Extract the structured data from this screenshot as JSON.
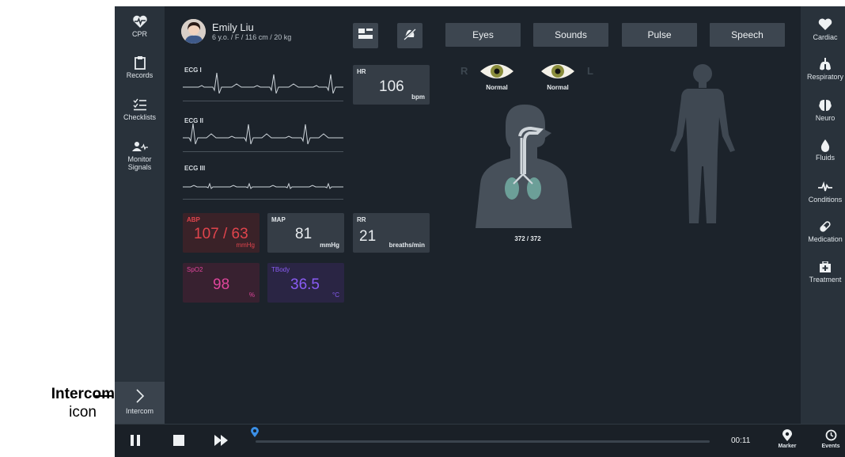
{
  "callout": {
    "bold": "Intercom",
    "normal": "icon"
  },
  "patient": {
    "name": "Emily Liu",
    "info": "6 y.o. / F / 116 cm / 20 kg"
  },
  "left_sidebar": {
    "items": [
      {
        "label": "CPR",
        "icon": "heart-pulse-icon"
      },
      {
        "label": "Records",
        "icon": "clipboard-icon"
      },
      {
        "label": "Checklists",
        "icon": "checklist-icon"
      },
      {
        "label": "Monitor Signals",
        "icon": "monitor-signals-icon"
      }
    ],
    "intercom": {
      "label": "Intercom",
      "icon": "chevron-right-icon"
    }
  },
  "right_sidebar": {
    "items": [
      {
        "label": "Cardiac",
        "icon": "heart-icon"
      },
      {
        "label": "Respiratory",
        "icon": "lungs-icon"
      },
      {
        "label": "Neuro",
        "icon": "brain-icon"
      },
      {
        "label": "Fluids",
        "icon": "drop-icon"
      },
      {
        "label": "Conditions",
        "icon": "pulse-icon"
      },
      {
        "label": "Medication",
        "icon": "pill-icon"
      },
      {
        "label": "Treatment",
        "icon": "first-aid-icon"
      }
    ]
  },
  "tabs": [
    "Eyes",
    "Sounds",
    "Pulse",
    "Speech"
  ],
  "ecg": [
    "ECG I",
    "ECG II",
    "ECG III"
  ],
  "vitals": {
    "hr": {
      "label": "HR",
      "value": "106",
      "unit": "bpm"
    },
    "abp": {
      "label": "ABP",
      "value": "107 / 63",
      "unit": "mmHg"
    },
    "map": {
      "label": "MAP",
      "value": "81",
      "unit": "mmHg"
    },
    "rr": {
      "label": "RR",
      "value": "21",
      "unit": "breaths/min"
    },
    "spo2": {
      "label": "SpO2",
      "value": "98",
      "unit": "%"
    },
    "tbody": {
      "label": "TBody",
      "value": "36.5",
      "unit": "°C"
    }
  },
  "eyes": {
    "right_marker": "R",
    "left_marker": "L",
    "right_status": "Normal",
    "left_status": "Normal"
  },
  "airway_readout": "372 / 372",
  "bottom_bar": {
    "time": "00:11",
    "marker_label": "Marker",
    "events_label": "Events",
    "progress_fraction": 0.0
  },
  "colors": {
    "abp": "#e0444c",
    "spo2": "#e0459c",
    "tbody": "#8a5cf5",
    "accent": "#3a8fe6",
    "abp_bg": "#3a2228",
    "spo2_bg": "#382130",
    "tbody_bg": "#2a2544"
  }
}
